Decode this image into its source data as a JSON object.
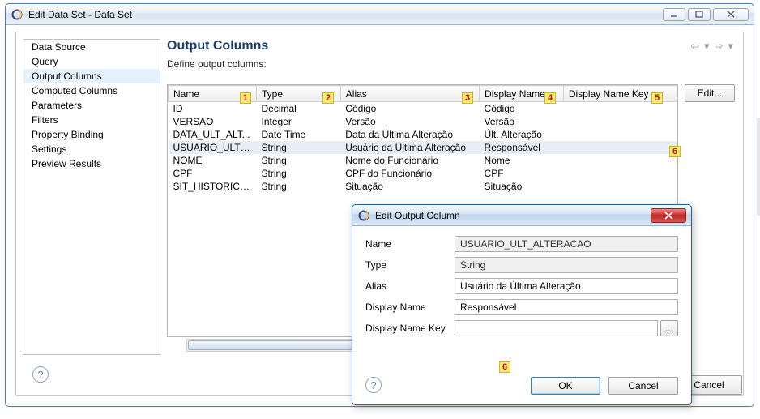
{
  "window": {
    "title": "Edit Data Set - Data Set"
  },
  "sidebar": {
    "items": [
      "Data Source",
      "Query",
      "Output Columns",
      "Computed Columns",
      "Parameters",
      "Filters",
      "Property Binding",
      "Settings",
      "Preview Results"
    ],
    "selected_index": 2
  },
  "main": {
    "heading": "Output Columns",
    "subtext": "Define output columns:",
    "edit_button": "Edit...",
    "columns": [
      "Name",
      "Type",
      "Alias",
      "Display Name",
      "Display Name Key"
    ],
    "rows": [
      {
        "name": "ID",
        "type": "Decimal",
        "alias": "Código",
        "display": "Código",
        "key": ""
      },
      {
        "name": "VERSAO",
        "type": "Integer",
        "alias": "Versão",
        "display": "Versão",
        "key": ""
      },
      {
        "name": "DATA_ULT_ALT...",
        "type": "Date Time",
        "alias": "Data da Última Alteração",
        "display": "Últ. Alteração",
        "key": ""
      },
      {
        "name": "USUARIO_ULT_...",
        "type": "String",
        "alias": "Usuário da Última Alteração",
        "display": "Responsável",
        "key": ""
      },
      {
        "name": "NOME",
        "type": "String",
        "alias": "Nome do Funcionário",
        "display": "Nome",
        "key": ""
      },
      {
        "name": "CPF",
        "type": "String",
        "alias": "CPF do Funcionário",
        "display": "CPF",
        "key": ""
      },
      {
        "name": "SIT_HISTORICO...",
        "type": "String",
        "alias": "Situação",
        "display": "Situação",
        "key": ""
      }
    ],
    "selected_row": 3
  },
  "footer": {
    "cancel": "Cancel"
  },
  "dialog": {
    "title": "Edit Output Column",
    "labels": {
      "name": "Name",
      "type": "Type",
      "alias": "Alias",
      "display": "Display Name",
      "key": "Display Name Key"
    },
    "values": {
      "name": "USUARIO_ULT_ALTERACAO",
      "type": "String",
      "alias": "Usuário da Última Alteração",
      "display": "Responsável",
      "key": ""
    },
    "ok": "OK",
    "cancel": "Cancel",
    "browse": "..."
  },
  "annotations": {
    "a1": "1",
    "a2": "2",
    "a3": "3",
    "a4": "4",
    "a5": "5",
    "a6": "6"
  }
}
